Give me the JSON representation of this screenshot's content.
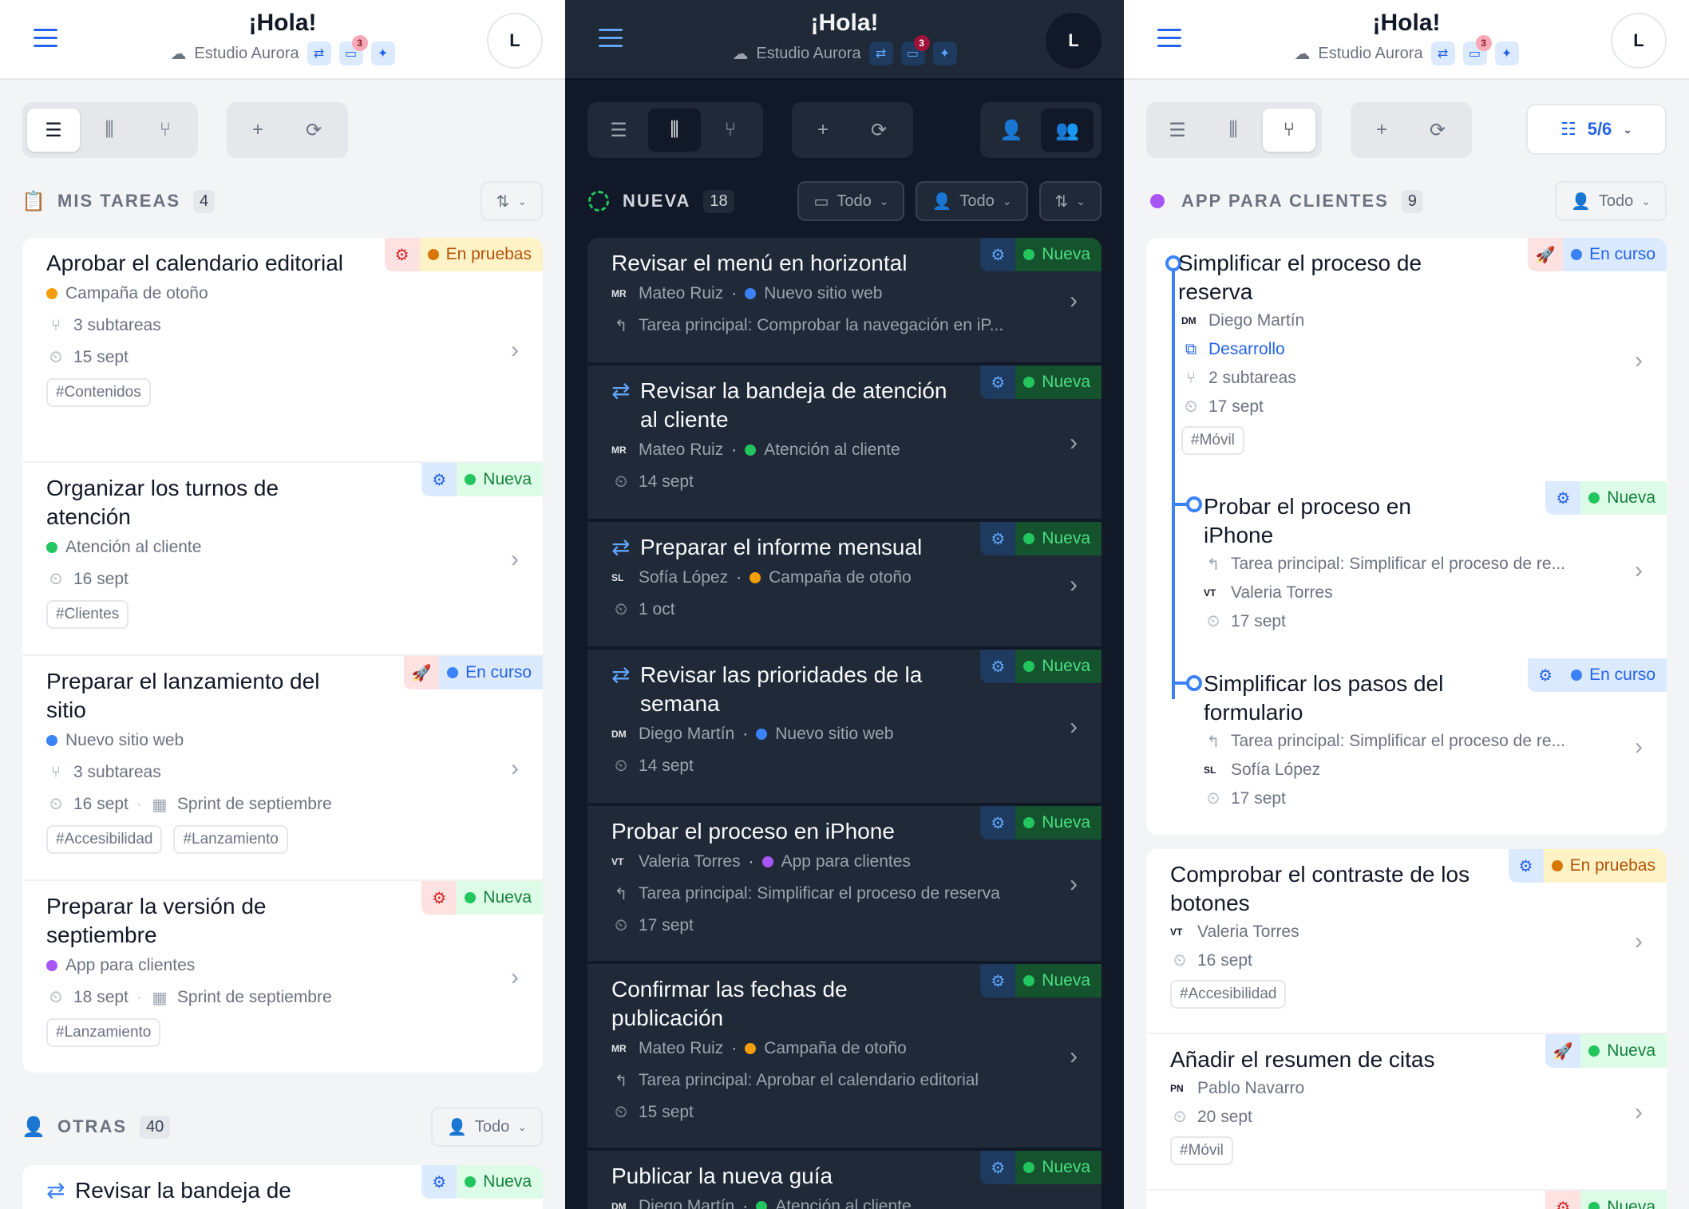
{
  "header": {
    "greeting": "¡Hola!",
    "workspace": "Estudio Aurora",
    "notif_count": "3",
    "avatar": "L"
  },
  "panels": [
    {
      "theme": "light",
      "sections": [
        {
          "title": "MIS TAREAS",
          "count": "4",
          "controls": [],
          "tasks": [
            {
              "title": "Aprobar el calendario editorial",
              "status": "En pruebas",
              "lines": [
                {
                  "dot": "#f59e0b",
                  "text": "Campaña de otoño"
                },
                {
                  "icon": "subtasks-icon",
                  "text": "3 subtareas"
                },
                {
                  "icon": "date-icon",
                  "text": "15 sept"
                }
              ],
              "tags": [
                "#Contenidos"
              ]
            },
            {
              "title": "Organizar los turnos de atención",
              "status": "Nueva",
              "lines": [
                {
                  "dot": "#22c55e",
                  "text": "Atención al cliente"
                },
                {
                  "icon": "date-icon",
                  "text": "16 sept"
                }
              ],
              "tags": [
                "#Clientes"
              ]
            },
            {
              "title": "Preparar el lanzamiento del sitio",
              "status": "En curso",
              "lines": [
                {
                  "dot": "#3b82f6",
                  "text": "Nuevo sitio web"
                },
                {
                  "icon": "subtasks-icon",
                  "text": "3 subtareas"
                },
                {
                  "icon": "date-icon",
                  "text": "16 sept",
                  "extra": "Sprint de septiembre"
                }
              ],
              "tags": [
                "#Accesibilidad",
                "#Lanzamiento"
              ]
            },
            {
              "title": "Preparar la versión de septiembre",
              "status": "Nueva",
              "lines": [
                {
                  "dot": "#a855f7",
                  "text": "App para clientes"
                },
                {
                  "icon": "date-icon",
                  "text": "18 sept",
                  "extra": "Sprint de septiembre"
                }
              ],
              "tags": [
                "#Lanzamiento"
              ]
            }
          ]
        },
        {
          "title": "OTRAS",
          "count": "40",
          "filter": "Todo",
          "tasks": [
            {
              "title": "Revisar la bandeja de atención al cliente",
              "status": "Nueva"
            }
          ]
        }
      ]
    },
    {
      "theme": "dark",
      "section": {
        "title": "NUEVA",
        "count": "18",
        "filter1": "Todo",
        "filter2": "Todo"
      },
      "tasks": [
        {
          "title": "Revisar el menú en horizontal",
          "status": "Nueva",
          "ini": "MR",
          "person": "Mateo Ruiz",
          "dot": "#3b82f6",
          "project": "Nuevo sitio web",
          "parent": "Tarea principal: Comprobar la navegación en iP..."
        },
        {
          "title": "Revisar la bandeja de atención al cliente",
          "status": "Nueva",
          "ini": "MR",
          "person": "Mateo Ruiz",
          "dot": "#22c55e",
          "project": "Atención al cliente",
          "date": "14 sept",
          "recurring": true
        },
        {
          "title": "Preparar el informe mensual",
          "status": "Nueva",
          "ini": "SL",
          "person": "Sofía López",
          "dot": "#f59e0b",
          "project": "Campaña de otoño",
          "date": "1 oct",
          "recurring": true
        },
        {
          "title": "Revisar las prioridades de la semana",
          "status": "Nueva",
          "ini": "DM",
          "person": "Diego Martín",
          "dot": "#3b82f6",
          "project": "Nuevo sitio web",
          "date": "14 sept",
          "recurring": true
        },
        {
          "title": "Probar el proceso en iPhone",
          "status": "Nueva",
          "ini": "VT",
          "person": "Valeria Torres",
          "dot": "#a855f7",
          "project": "App para clientes",
          "parent": "Tarea principal: Simplificar el proceso de reserva",
          "date": "17 sept"
        },
        {
          "title": "Confirmar las fechas de publicación",
          "status": "Nueva",
          "ini": "MR",
          "person": "Mateo Ruiz",
          "dot": "#f59e0b",
          "project": "Campaña de otoño",
          "parent": "Tarea principal: Aprobar el calendario editorial",
          "date": "15 sept"
        },
        {
          "title": "Publicar la nueva guía",
          "status": "Nueva",
          "ini": "DM",
          "person": "Diego Martín",
          "dot": "#22c55e",
          "project": "Atención al cliente"
        }
      ]
    },
    {
      "theme": "light",
      "filter_count": "5/6",
      "section": {
        "title": "APP PARA CLIENTES",
        "count": "9",
        "filter": "Todo"
      },
      "tree": {
        "title": "Simplificar el proceso de reserva",
        "status": "En curso",
        "ini": "DM",
        "person": "Diego Martín",
        "stage": "Desarrollo",
        "subtasks": "2 subtareas",
        "date": "17 sept",
        "tag": "#Móvil",
        "children": [
          {
            "title": "Probar el proceso en iPhone",
            "status": "Nueva",
            "parent": "Tarea principal: Simplificar el proceso de re...",
            "ini": "VT",
            "person": "Valeria Torres",
            "date": "17 sept"
          },
          {
            "title": "Simplificar los pasos del formulario",
            "status": "En curso",
            "parent": "Tarea principal: Simplificar el proceso de re...",
            "ini": "SL",
            "person": "Sofía López",
            "date": "17 sept"
          }
        ]
      },
      "tasks": [
        {
          "title": "Comprobar el contraste de los botones",
          "status": "En pruebas",
          "ini": "VT",
          "person": "Valeria Torres",
          "date": "16 sept",
          "tag": "#Accesibilidad"
        },
        {
          "title": "Añadir el resumen de citas",
          "status": "Nueva",
          "ini": "PN",
          "person": "Pablo Navarro",
          "date": "20 sept",
          "tag": "#Móvil"
        },
        {
          "title": "",
          "status": "Nueva"
        }
      ]
    }
  ]
}
